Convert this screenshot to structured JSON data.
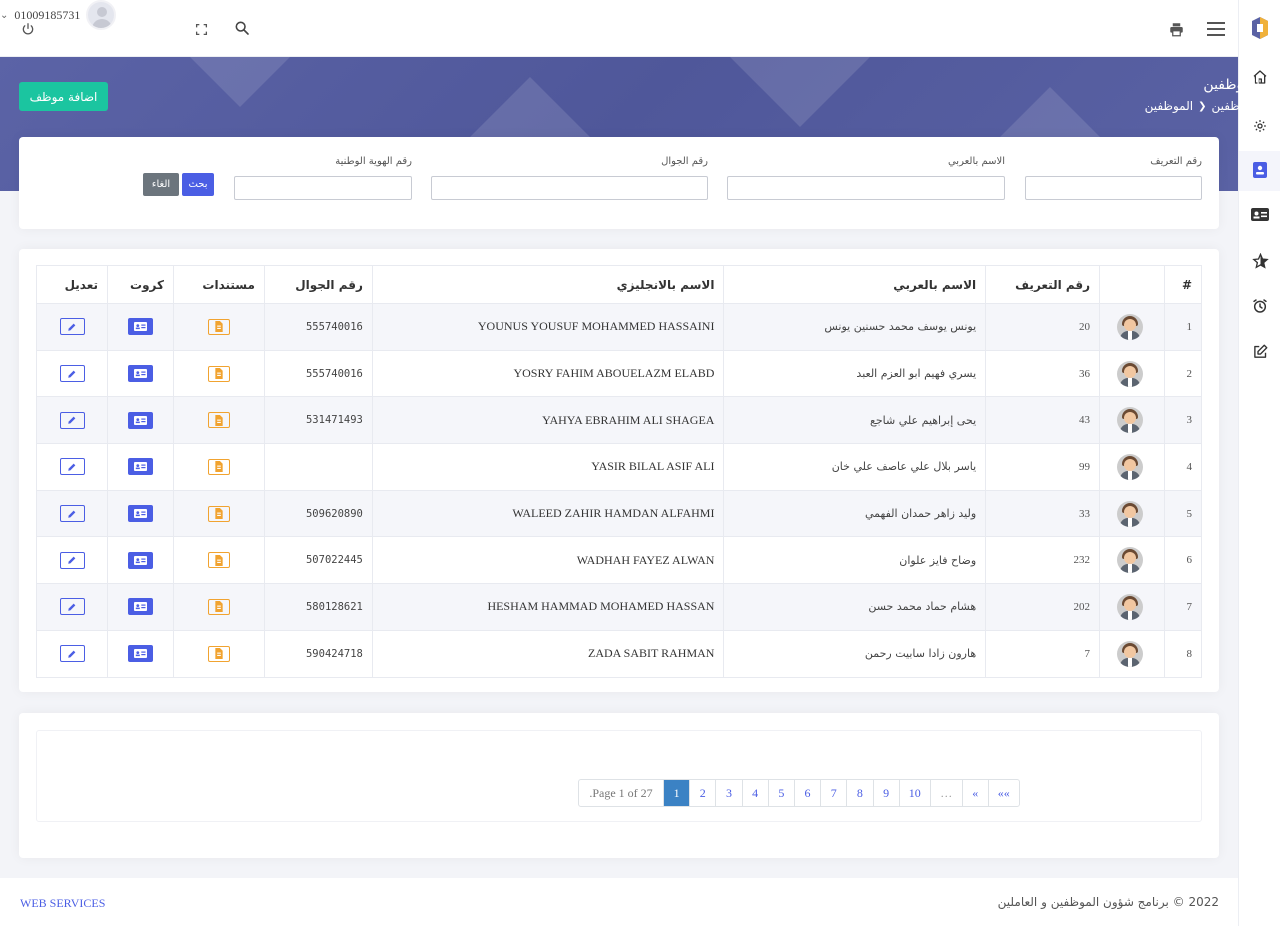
{
  "topbar": {
    "phone": "01009185731",
    "icons": [
      "power-icon",
      "chevron-down-icon",
      "expand-icon",
      "search-icon",
      "print-icon",
      "menu-icon"
    ]
  },
  "header": {
    "title": "الموظفين",
    "breadcrumb": [
      "الموظفين",
      "الموظفين"
    ],
    "add_button": "اضافة موظف"
  },
  "filters": {
    "id_label": "رقم التعريف",
    "arabic_name_label": "الاسم بالعربي",
    "mobile_label": "رقم الجوال",
    "national_id_label": "رقم الهوية الوطنية",
    "search_button": "بحث",
    "cancel_button": "الغاء",
    "values": {
      "id": "",
      "arabic_name": "",
      "mobile": "",
      "national_id": ""
    }
  },
  "table": {
    "headers": {
      "num": "#",
      "avatar": "",
      "id": "رقم التعريف",
      "arabic_name": "الاسم بالعربي",
      "english_name": "الاسم بالانجليزي",
      "mobile": "رقم الجوال",
      "documents": "مستندات",
      "cards": "كروت",
      "edit": "تعديل"
    },
    "rows": [
      {
        "num": "1",
        "id": "20",
        "arabic_name": "يونس يوسف محمد حسنين يونس",
        "english_name": "YOUNUS YOUSUF MOHAMMED HASSAINI",
        "mobile": "555740016"
      },
      {
        "num": "2",
        "id": "36",
        "arabic_name": "يسري فهيم ابو العزم العبد",
        "english_name": "YOSRY FAHIM ABOUELAZM ELABD",
        "mobile": "555740016"
      },
      {
        "num": "3",
        "id": "43",
        "arabic_name": "يحى إبراهيم علي شاجع",
        "english_name": "YAHYA EBRAHIM ALI SHAGEA",
        "mobile": "531471493"
      },
      {
        "num": "4",
        "id": "99",
        "arabic_name": "ياسر بلال علي عاصف علي خان",
        "english_name": "YASIR BILAL ASIF ALI",
        "mobile": ""
      },
      {
        "num": "5",
        "id": "33",
        "arabic_name": "وليد زاهر حمدان الفهمي",
        "english_name": "WALEED ZAHIR HAMDAN ALFAHMI",
        "mobile": "509620890"
      },
      {
        "num": "6",
        "id": "232",
        "arabic_name": "وضاح فايز علوان",
        "english_name": "WADHAH FAYEZ ALWAN",
        "mobile": "507022445"
      },
      {
        "num": "7",
        "id": "202",
        "arabic_name": "هشام حماد محمد حسن",
        "english_name": "HESHAM HAMMAD MOHAMED HASSAN",
        "mobile": "580128621"
      },
      {
        "num": "8",
        "id": "7",
        "arabic_name": "هارون زادا سابيت رحمن",
        "english_name": "ZADA SABIT RAHMAN",
        "mobile": "590424718"
      }
    ]
  },
  "pagination": {
    "info": ".Page 1 of 27",
    "pages": [
      "1",
      "2",
      "3",
      "4",
      "5",
      "6",
      "7",
      "8",
      "9",
      "10"
    ],
    "active": "1",
    "dots": "…",
    "prev": "«",
    "first": "««"
  },
  "footer": {
    "left": "WEB SERVICES",
    "right": "2022 © برنامج شؤون الموظفين و العاملين"
  }
}
